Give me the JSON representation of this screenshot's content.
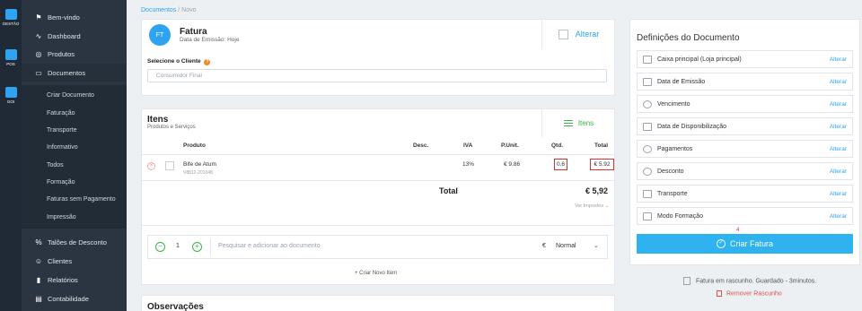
{
  "rail": [
    {
      "label": "GESTÃO",
      "icon": "grid-icon"
    },
    {
      "label": "POS",
      "icon": "monitor-icon"
    },
    {
      "label": "GOI",
      "icon": "goi-icon"
    }
  ],
  "sidebar": {
    "items": [
      {
        "label": "Bem-vindo",
        "icon": "flag-icon"
      },
      {
        "label": "Dashboard",
        "icon": "pulse-icon"
      },
      {
        "label": "Produtos",
        "icon": "box-icon"
      },
      {
        "label": "Documentos",
        "icon": "folder-icon"
      }
    ],
    "sub_items": [
      "Criar Documento",
      "Faturação",
      "Transporte",
      "Informativo",
      "Todos",
      "Formação",
      "Faturas sem Pagamento",
      "Impressão"
    ],
    "bottom_items": [
      {
        "label": "Talões de Desconto",
        "icon": "percent-icon"
      },
      {
        "label": "Clientes",
        "icon": "users-icon"
      },
      {
        "label": "Relatórios",
        "icon": "chart-icon"
      },
      {
        "label": "Contabilidade",
        "icon": "file-icon"
      }
    ]
  },
  "breadcrumb": {
    "parent": "Documentos",
    "separator": "/",
    "current": "Novo"
  },
  "document": {
    "initials": "FT",
    "title": "Fatura",
    "subtitle": "Data de Emissão: Hoje",
    "alter_label": "Alterar"
  },
  "client": {
    "label": "Selecione o Cliente",
    "help": "?",
    "value": "Consumidor Final"
  },
  "items": {
    "title": "Itens",
    "subtitle": "Produtos e Serviços",
    "tab_label": "Itens",
    "headers": {
      "produto": "Produto",
      "desc": "Desc.",
      "iva": "IVA",
      "punit": "P.Unit.",
      "qtd": "Qtd.",
      "total": "Total"
    },
    "rows": [
      {
        "name": "Bife de Atum",
        "code": "V8812-201048",
        "iva": "13%",
        "punit": "€ 9.86",
        "qtd": "0.6",
        "total": "€ 5.92"
      }
    ],
    "total_label": "Total",
    "total_value": "€ 5,92",
    "taxes_link": "Ver Impostos ⌄"
  },
  "add_bar": {
    "minus": "−",
    "qty": "1",
    "plus": "+",
    "placeholder": "Pesquisar e adicionar ao documento",
    "currency": "€",
    "price_mode": "Normal",
    "create_item": "+ Criar Novo Item"
  },
  "observations": {
    "title": "Observações"
  },
  "settings": {
    "title": "Definições do Documento",
    "rows": [
      {
        "label": "Caixa principal (Loja principal)",
        "action": "Alterar",
        "icon": "register-icon"
      },
      {
        "label": "Data de Emissão",
        "action": "Alterar",
        "icon": "calendar-icon"
      },
      {
        "label": "Vencimento",
        "action": "Alterar",
        "icon": "clock-icon"
      },
      {
        "label": "Data de Disponibilização",
        "action": "Alterar",
        "icon": "calendar-icon"
      },
      {
        "label": "Pagamentos",
        "action": "Alterar",
        "icon": "coin-icon"
      },
      {
        "label": "Desconto",
        "action": "Alterar",
        "icon": "discount-icon"
      },
      {
        "label": "Transporte",
        "action": "Alterar",
        "icon": "truck-icon"
      },
      {
        "label": "Modo Formação",
        "action": "Alterar",
        "icon": "graduation-icon"
      }
    ],
    "step_marker": "4",
    "create_label": "Criar Fatura"
  },
  "draft": {
    "status": "Fatura em rascunho. Guardado - 3minutos.",
    "remove": "Remover Rascunho"
  }
}
